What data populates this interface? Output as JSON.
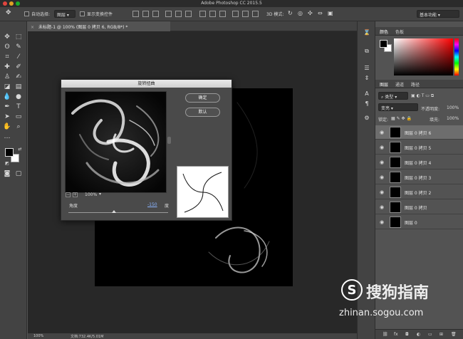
{
  "app": {
    "title": "Adobe Photoshop CC 2015.5"
  },
  "options_bar": {
    "auto_select_label": "自动选择:",
    "auto_select_target": "图层",
    "show_transform_label": "显示变换控件",
    "mode_3d_label": "3D 模式:",
    "workspace": "基本功能"
  },
  "document": {
    "tab_title": "未标题-1 @ 100% (图层 0 拷贝 6, RGB/8*) *",
    "zoom": "100%",
    "doc_size": "文档:732.4K/5.01M"
  },
  "dialog": {
    "title": "旋转扭曲",
    "ok_label": "确定",
    "default_label": "默认",
    "zoom_out": "−",
    "zoom_in": "+",
    "zoom_level": "100%",
    "angle_label": "角度",
    "angle_value": "-150",
    "angle_unit": "度",
    "angle_fraction": 0.46
  },
  "panels": {
    "color_tabs": [
      "颜色",
      "色板"
    ],
    "layers_tabs": [
      "图层",
      "通道",
      "路径"
    ],
    "kind_filter": "类型",
    "blend_mode": "变亮",
    "opacity_label": "不透明度:",
    "opacity_value": "100%",
    "lock_label": "锁定:",
    "fill_label": "填充:",
    "fill_value": "100%",
    "layers": [
      {
        "name": "图层 0 拷贝 6",
        "selected": true
      },
      {
        "name": "图层 0 拷贝 5",
        "selected": false
      },
      {
        "name": "图层 0 拷贝 4",
        "selected": false
      },
      {
        "name": "图层 0 拷贝 3",
        "selected": false
      },
      {
        "name": "图层 0 拷贝 2",
        "selected": false
      },
      {
        "name": "图层 0 拷贝",
        "selected": false
      },
      {
        "name": "图层 0",
        "selected": false
      }
    ]
  },
  "watermark": {
    "brand_cn": "搜狗指南",
    "url": "zhinan.sogou.com"
  },
  "colors": {
    "ui_dark": "#434343",
    "canvas_bg": "#282828",
    "selected_layer": "#6d6d6d"
  }
}
